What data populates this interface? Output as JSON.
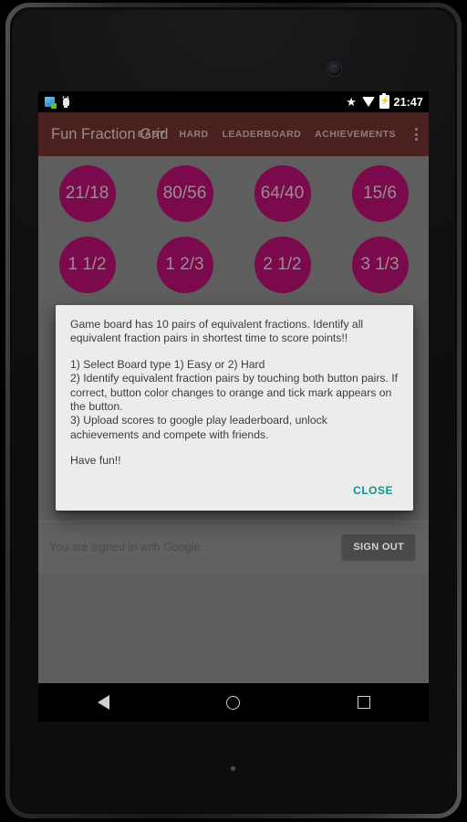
{
  "device": {
    "camera_icon": "camera-icon",
    "led_icon": "notification-led"
  },
  "status_bar": {
    "time": "21:47",
    "left_icons": [
      {
        "name": "app-update-icon"
      },
      {
        "name": "android-debug-icon"
      }
    ],
    "right_icons": [
      {
        "name": "star-icon",
        "glyph": "★"
      },
      {
        "name": "wifi-icon"
      },
      {
        "name": "battery-charging-icon",
        "glyph": "⚡"
      }
    ]
  },
  "app_bar": {
    "title": "Fun Fraction Grid",
    "background_color": "#4a211e",
    "menu": [
      {
        "label": "EASY",
        "name": "menu-item-easy"
      },
      {
        "label": "HARD",
        "name": "menu-item-hard"
      },
      {
        "label": "LEADERBOARD",
        "name": "menu-item-leaderboard"
      },
      {
        "label": "ACHIEVEMENTS",
        "name": "menu-item-achievements"
      }
    ],
    "overflow_icon": "overflow-menu-icon"
  },
  "game_board": {
    "circle_color": "#7a0a4b",
    "rows": [
      {
        "cells": [
          "21/18",
          "80/56",
          "64/40",
          "15/6"
        ]
      },
      {
        "cells": [
          "1 1/2",
          "1 2/3",
          "2 1/2",
          "3 1/3"
        ]
      },
      {
        "cells": [
          "",
          "",
          "",
          ""
        ]
      }
    ]
  },
  "sign_in_bar": {
    "text": "You are signed in with Google.",
    "sign_out_label": "SIGN OUT"
  },
  "dialog": {
    "paragraphs": [
      "Game board has 10 pairs of equivalent fractions. Identify all equivalent fraction pairs in shortest time to score points!!",
      "1) Select Board type 1) Easy or 2) Hard\n2) Identify equivalent fraction pairs by touching both button pairs. If correct, button color changes to orange and tick mark appears on the button.\n3) Upload scores to google play leaderboard, unlock achievements and compete with friends.",
      "Have fun!!"
    ],
    "p1": "Game board has 10 pairs of equivalent fractions. Identify all equivalent fraction pairs in shortest time to score points!!",
    "p2_line1": "1) Select Board type 1) Easy or 2) Hard",
    "p2_line2": "2) Identify equivalent fraction pairs by touching both button pairs. If correct, button color changes to orange and tick mark appears on the button.",
    "p2_line3": "3) Upload scores to google play leaderboard, unlock achievements and compete with friends.",
    "p3": "Have fun!!",
    "close_label": "CLOSE",
    "close_color": "#0a968c"
  },
  "nav_bar": {
    "buttons": [
      {
        "name": "nav-back-button"
      },
      {
        "name": "nav-home-button"
      },
      {
        "name": "nav-recents-button"
      }
    ]
  }
}
